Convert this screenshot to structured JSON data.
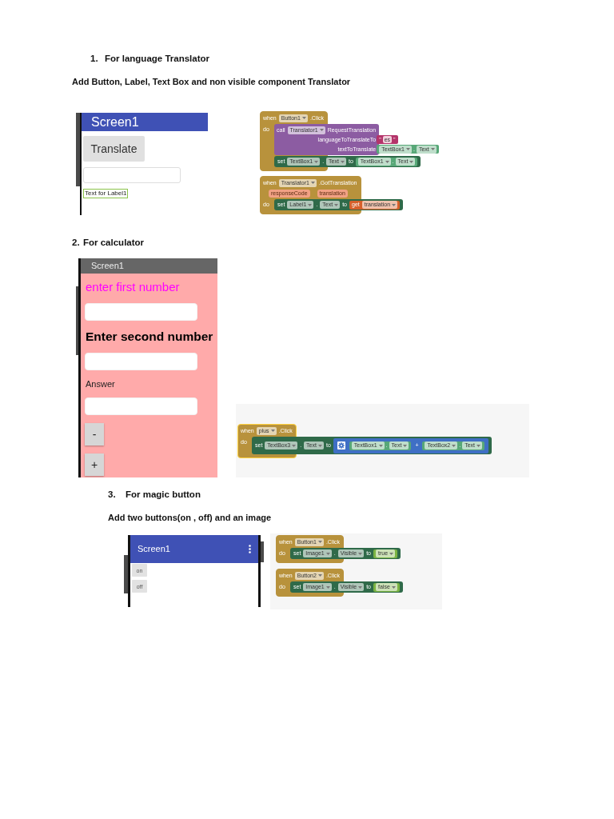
{
  "sections": [
    {
      "kind": "numbered",
      "number": "1.",
      "title": "For language Translator",
      "instruction": "Add Button, Label, Text Box and non visible component Translator",
      "preview": {
        "kind": "translator",
        "title": "Screen1",
        "components": [
          {
            "kind": "button",
            "text": "Translate",
            "selected": false
          },
          {
            "kind": "textbox",
            "selected": false
          },
          {
            "kind": "label",
            "text": "Text for Label1",
            "selected": true
          }
        ]
      },
      "blocks": [
        {
          "kind": "event",
          "selected": false,
          "keyword": "when",
          "component": "Button1",
          "event": ".Click",
          "do": "do",
          "body": [
            {
              "kind": "call",
              "keyword": "call",
              "component": "Translator1",
              "method": "RequestTranslation",
              "args": [
                {
                  "name": "languageToTranslateTo",
                  "value": {
                    "kind": "text",
                    "open_quote": "\"",
                    "text": "es",
                    "close_quote": "\""
                  }
                },
                {
                  "name": "textToTranslate",
                  "value": {
                    "kind": "property",
                    "component": "TextBox1",
                    "dot": ".",
                    "property": "Text"
                  }
                }
              ]
            },
            {
              "kind": "set",
              "keyword": "set",
              "component": "TextBox1",
              "dot": ".",
              "property": "Text",
              "to": "to",
              "value": {
                "kind": "property",
                "component": "TextBox1",
                "dot": ".",
                "property": "Text"
              }
            }
          ]
        },
        {
          "kind": "event",
          "selected": false,
          "keyword": "when",
          "component": "Translator1",
          "event": ".GotTranslation",
          "params": [
            "responseCode",
            "translation"
          ],
          "do": "do",
          "body": [
            {
              "kind": "set",
              "keyword": "set",
              "component": "Label1",
              "dot": ".",
              "property": "Text",
              "to": "to",
              "value": {
                "kind": "local_get",
                "keyword": "get",
                "variable": "translation"
              }
            }
          ]
        }
      ]
    },
    {
      "kind": "plain",
      "number": "2.",
      "title": "For calculator",
      "preview": {
        "kind": "calculator",
        "title": "Screen1",
        "components": [
          {
            "kind": "prompt_label",
            "text": "enter first number",
            "color": "#ff00ff",
            "selected": false
          },
          {
            "kind": "textbox",
            "selected": false
          },
          {
            "kind": "bold_label",
            "text": "Enter second number",
            "selected": false
          },
          {
            "kind": "textbox",
            "selected": false
          },
          {
            "kind": "label",
            "text": "Answer",
            "selected": false
          },
          {
            "kind": "textbox",
            "selected": false
          },
          {
            "kind": "button",
            "text": "-",
            "selected": false
          },
          {
            "kind": "button",
            "text": "+",
            "selected": false
          }
        ]
      },
      "blocks": [
        {
          "kind": "event",
          "selected": true,
          "keyword": "when",
          "component": "plus",
          "event": ".Click",
          "do": "do",
          "body": [
            {
              "kind": "set",
              "keyword": "set",
              "component": "TextBox3",
              "dot": ".",
              "property": "Text",
              "to": "to",
              "value": {
                "kind": "math",
                "operator": "+",
                "operands": [
                  {
                    "kind": "property",
                    "component": "TextBox1",
                    "dot": ".",
                    "property": "Text"
                  },
                  {
                    "kind": "property",
                    "component": "TextBox2",
                    "dot": ".",
                    "property": "Text"
                  }
                ]
              }
            }
          ]
        }
      ]
    },
    {
      "kind": "indented",
      "number": "3.",
      "title": "For magic button",
      "instruction": "Add two buttons(on , off) and an image",
      "preview": {
        "kind": "magic",
        "title": "Screen1",
        "components": [
          {
            "kind": "button",
            "text": "on",
            "selected": false
          },
          {
            "kind": "button",
            "text": "off",
            "selected": false
          }
        ]
      },
      "blocks": [
        {
          "kind": "event",
          "selected": false,
          "keyword": "when",
          "component": "Button1",
          "event": ".Click",
          "do": "do",
          "body": [
            {
              "kind": "set",
              "keyword": "set",
              "component": "Image1",
              "dot": ".",
              "property": "Visible",
              "to": "to",
              "value": {
                "kind": "logic",
                "value": "true"
              }
            }
          ]
        },
        {
          "kind": "event",
          "selected": false,
          "keyword": "when",
          "component": "Button2",
          "event": ".Click",
          "do": "do",
          "body": [
            {
              "kind": "set",
              "keyword": "set",
              "component": "Image1",
              "dot": ".",
              "property": "Visible",
              "to": "to",
              "value": {
                "kind": "logic",
                "value": "false"
              }
            }
          ]
        }
      ]
    }
  ]
}
